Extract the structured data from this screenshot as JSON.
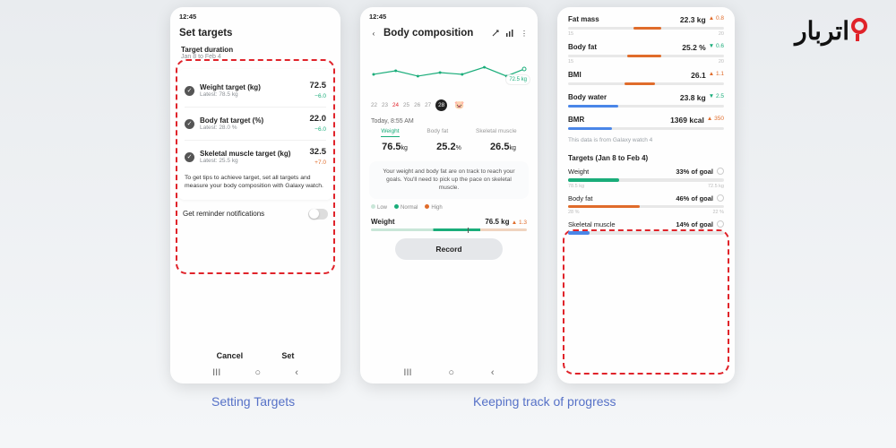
{
  "logo_text": "اتربار",
  "captions": {
    "c1": "Setting Targets",
    "c2": "Keeping track of progress"
  },
  "phone1": {
    "time": "12:45",
    "title": "Set targets",
    "duration_label": "Target duration",
    "duration_value": "Jan 8 to  Feb 4",
    "rows": [
      {
        "label": "Weight target (kg)",
        "sub": "Latest: 78.5 kg",
        "val": "72.5",
        "delta": "−6.0",
        "dir": "down"
      },
      {
        "label": "Body fat target (%)",
        "sub": "Latest: 28.0 %",
        "val": "22.0",
        "delta": "−6.0",
        "dir": "down"
      },
      {
        "label": "Skeletal muscle target (kg)",
        "sub": "Latest: 25.5 kg",
        "val": "32.5",
        "delta": "+7.0",
        "dir": "up"
      }
    ],
    "tip": "To get tips to achieve target, set all targets and measure your body composition with Galaxy watch.",
    "reminder_label": "Get reminder notifications",
    "cancel": "Cancel",
    "set": "Set"
  },
  "phone2": {
    "time": "12:45",
    "title": "Body composition",
    "chart_value": "72.5 kg",
    "dates": [
      "22",
      "23",
      "24",
      "25",
      "26",
      "27",
      "28"
    ],
    "selected_date": "28",
    "today": "Today, 8:55 AM",
    "tabs": [
      "Weight",
      "Body fat",
      "Skeletal muscle"
    ],
    "vals": [
      {
        "n": "76.5",
        "u": "kg"
      },
      {
        "n": "25.2",
        "u": "%"
      },
      {
        "n": "26.5",
        "u": "kg"
      }
    ],
    "msg": "Your weight and body fat are on track to reach your goals. You'll need to pick up the pace on skeletal muscle.",
    "legend": [
      "Low",
      "Normal",
      "High"
    ],
    "weight_label": "Weight",
    "weight_val": "76.5 kg",
    "weight_delta": "▲ 1.3",
    "record": "Record"
  },
  "phone3": {
    "metrics": [
      {
        "name": "Fat mass",
        "val": "22.3 kg",
        "delta": "▲ 0.8",
        "dir": "up",
        "fill_color": "#e06c2b",
        "fill_left": "42%",
        "fill_w": "18%",
        "ticks": [
          "15",
          "20"
        ]
      },
      {
        "name": "Body fat",
        "val": "25.2 %",
        "delta": "▼ 0.6",
        "dir": "down",
        "fill_color": "#e06c2b",
        "fill_left": "38%",
        "fill_w": "22%",
        "ticks": [
          "15",
          "20"
        ]
      },
      {
        "name": "BMI",
        "val": "26.1",
        "delta": "▲ 1.1",
        "dir": "up",
        "fill_color": "#e06c2b",
        "fill_left": "36%",
        "fill_w": "20%",
        "ticks": [
          "",
          ""
        ]
      },
      {
        "name": "Body water",
        "val": "23.8 kg",
        "delta": "▼ 2.5",
        "dir": "down",
        "fill_color": "#4a86e8",
        "fill_left": "0%",
        "fill_w": "32%",
        "ticks": [
          "",
          ""
        ]
      },
      {
        "name": "BMR",
        "val": "1369 kcal",
        "delta": "▲ 350",
        "dir": "up",
        "fill_color": "#4a86e8",
        "fill_left": "0%",
        "fill_w": "28%",
        "ticks": [
          "",
          ""
        ]
      }
    ],
    "source_note": "This data is from Galaxy watch 4",
    "targets_header": "Targets (Jan 8 to Feb 4)",
    "goals": [
      {
        "name": "Weight",
        "pct": "33% of goal",
        "color": "#1aad7a",
        "w": "33%",
        "start": "78.5 kg",
        "end": "72.5 kg"
      },
      {
        "name": "Body fat",
        "pct": "46% of goal",
        "color": "#e06c2b",
        "w": "46%",
        "start": "28 %",
        "end": "22 %"
      },
      {
        "name": "Skeletal muscle",
        "pct": "14% of goal",
        "color": "#4a86e8",
        "w": "14%",
        "start": "",
        "end": ""
      }
    ]
  }
}
